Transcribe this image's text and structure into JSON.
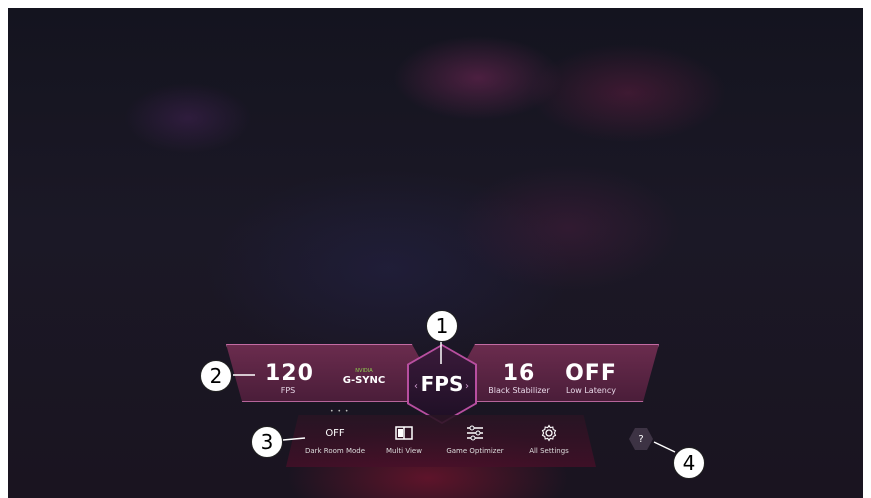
{
  "fps_panel": {
    "fps_value": "120",
    "fps_label": "FPS",
    "gsync_brand": "NVIDIA",
    "gsync_label": "G-SYNC",
    "black_stabilizer_value": "16",
    "black_stabilizer_label": "Black Stabilizer",
    "low_latency_value": "OFF",
    "low_latency_label": "Low Latency"
  },
  "center": {
    "label": "FPS",
    "left_arrow": "‹",
    "right_arrow": "›"
  },
  "menu": {
    "items": [
      {
        "value": "OFF",
        "label": "Dark Room Mode",
        "icon": "text-value"
      },
      {
        "label": "Multi View",
        "icon": "multi-view-icon"
      },
      {
        "label": "Game Optimizer",
        "icon": "sliders-icon"
      },
      {
        "label": "All Settings",
        "icon": "gear-icon"
      }
    ]
  },
  "help": {
    "label": "?"
  },
  "callouts": [
    "1",
    "2",
    "3",
    "4"
  ],
  "colors": {
    "accent": "#b84fa0",
    "panel": "#5a2444",
    "background": "#181622"
  }
}
